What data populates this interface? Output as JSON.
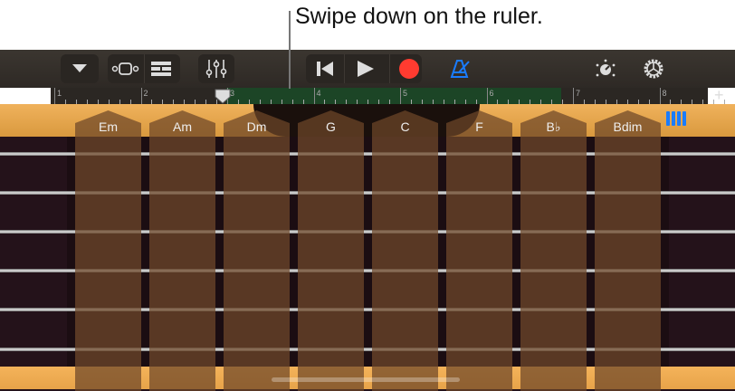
{
  "callout": "Swipe down on the ruler.",
  "ruler": {
    "bars": [
      "1",
      "2",
      "3",
      "4",
      "5",
      "6",
      "7",
      "8"
    ],
    "add_label": "+",
    "playhead_bar": 3,
    "cycle_region": [
      "3",
      "7"
    ]
  },
  "chords": [
    "Em",
    "Am",
    "Dm",
    "G",
    "C",
    "F",
    "B♭",
    "Bdim"
  ],
  "colors": {
    "accent": "#1a7cff",
    "record": "#ff3b30",
    "cycle": "#1c4526"
  }
}
